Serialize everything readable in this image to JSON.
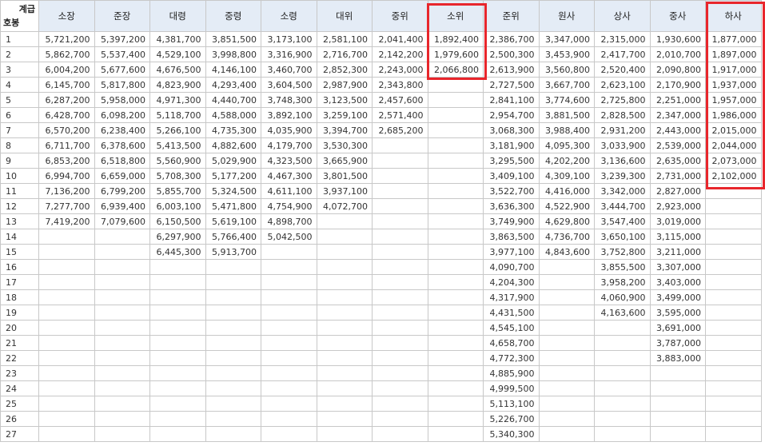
{
  "corner": {
    "grade_label": "계급",
    "step_label": "호봉"
  },
  "columns": [
    "소장",
    "준장",
    "대령",
    "중령",
    "소령",
    "대위",
    "중위",
    "소위",
    "준위",
    "원사",
    "상사",
    "중사",
    "하사"
  ],
  "rows": [
    {
      "n": "1",
      "v": [
        "5,721,200",
        "5,397,200",
        "4,381,700",
        "3,851,500",
        "3,173,100",
        "2,581,100",
        "2,041,400",
        "1,892,400",
        "2,386,700",
        "3,347,000",
        "2,315,000",
        "1,930,600",
        "1,877,000"
      ]
    },
    {
      "n": "2",
      "v": [
        "5,862,700",
        "5,537,400",
        "4,529,100",
        "3,998,800",
        "3,316,900",
        "2,716,700",
        "2,142,200",
        "1,979,600",
        "2,500,300",
        "3,453,900",
        "2,417,700",
        "2,010,700",
        "1,897,000"
      ]
    },
    {
      "n": "3",
      "v": [
        "6,004,200",
        "5,677,600",
        "4,676,500",
        "4,146,100",
        "3,460,700",
        "2,852,300",
        "2,243,000",
        "2,066,800",
        "2,613,900",
        "3,560,800",
        "2,520,400",
        "2,090,800",
        "1,917,000"
      ]
    },
    {
      "n": "4",
      "v": [
        "6,145,700",
        "5,817,800",
        "4,823,900",
        "4,293,400",
        "3,604,500",
        "2,987,900",
        "2,343,800",
        "",
        "2,727,500",
        "3,667,700",
        "2,623,100",
        "2,170,900",
        "1,937,000"
      ]
    },
    {
      "n": "5",
      "v": [
        "6,287,200",
        "5,958,000",
        "4,971,300",
        "4,440,700",
        "3,748,300",
        "3,123,500",
        "2,457,600",
        "",
        "2,841,100",
        "3,774,600",
        "2,725,800",
        "2,251,000",
        "1,957,000"
      ]
    },
    {
      "n": "6",
      "v": [
        "6,428,700",
        "6,098,200",
        "5,118,700",
        "4,588,000",
        "3,892,100",
        "3,259,100",
        "2,571,400",
        "",
        "2,954,700",
        "3,881,500",
        "2,828,500",
        "2,347,000",
        "1,986,000"
      ]
    },
    {
      "n": "7",
      "v": [
        "6,570,200",
        "6,238,400",
        "5,266,100",
        "4,735,300",
        "4,035,900",
        "3,394,700",
        "2,685,200",
        "",
        "3,068,300",
        "3,988,400",
        "2,931,200",
        "2,443,000",
        "2,015,000"
      ]
    },
    {
      "n": "8",
      "v": [
        "6,711,700",
        "6,378,600",
        "5,413,500",
        "4,882,600",
        "4,179,700",
        "3,530,300",
        "",
        "",
        "3,181,900",
        "4,095,300",
        "3,033,900",
        "2,539,000",
        "2,044,000"
      ]
    },
    {
      "n": "9",
      "v": [
        "6,853,200",
        "6,518,800",
        "5,560,900",
        "5,029,900",
        "4,323,500",
        "3,665,900",
        "",
        "",
        "3,295,500",
        "4,202,200",
        "3,136,600",
        "2,635,000",
        "2,073,000"
      ]
    },
    {
      "n": "10",
      "v": [
        "6,994,700",
        "6,659,000",
        "5,708,300",
        "5,177,200",
        "4,467,300",
        "3,801,500",
        "",
        "",
        "3,409,100",
        "4,309,100",
        "3,239,300",
        "2,731,000",
        "2,102,000"
      ]
    },
    {
      "n": "11",
      "v": [
        "7,136,200",
        "6,799,200",
        "5,855,700",
        "5,324,500",
        "4,611,100",
        "3,937,100",
        "",
        "",
        "3,522,700",
        "4,416,000",
        "3,342,000",
        "2,827,000",
        ""
      ]
    },
    {
      "n": "12",
      "v": [
        "7,277,700",
        "6,939,400",
        "6,003,100",
        "5,471,800",
        "4,754,900",
        "4,072,700",
        "",
        "",
        "3,636,300",
        "4,522,900",
        "3,444,700",
        "2,923,000",
        ""
      ]
    },
    {
      "n": "13",
      "v": [
        "7,419,200",
        "7,079,600",
        "6,150,500",
        "5,619,100",
        "4,898,700",
        "",
        "",
        "",
        "3,749,900",
        "4,629,800",
        "3,547,400",
        "3,019,000",
        ""
      ]
    },
    {
      "n": "14",
      "v": [
        "",
        "",
        "6,297,900",
        "5,766,400",
        "5,042,500",
        "",
        "",
        "",
        "3,863,500",
        "4,736,700",
        "3,650,100",
        "3,115,000",
        ""
      ]
    },
    {
      "n": "15",
      "v": [
        "",
        "",
        "6,445,300",
        "5,913,700",
        "",
        "",
        "",
        "",
        "3,977,100",
        "4,843,600",
        "3,752,800",
        "3,211,000",
        ""
      ]
    },
    {
      "n": "16",
      "v": [
        "",
        "",
        "",
        "",
        "",
        "",
        "",
        "",
        "4,090,700",
        "",
        "3,855,500",
        "3,307,000",
        ""
      ]
    },
    {
      "n": "17",
      "v": [
        "",
        "",
        "",
        "",
        "",
        "",
        "",
        "",
        "4,204,300",
        "",
        "3,958,200",
        "3,403,000",
        ""
      ]
    },
    {
      "n": "18",
      "v": [
        "",
        "",
        "",
        "",
        "",
        "",
        "",
        "",
        "4,317,900",
        "",
        "4,060,900",
        "3,499,000",
        ""
      ]
    },
    {
      "n": "19",
      "v": [
        "",
        "",
        "",
        "",
        "",
        "",
        "",
        "",
        "4,431,500",
        "",
        "4,163,600",
        "3,595,000",
        ""
      ]
    },
    {
      "n": "20",
      "v": [
        "",
        "",
        "",
        "",
        "",
        "",
        "",
        "",
        "4,545,100",
        "",
        "",
        "3,691,000",
        ""
      ]
    },
    {
      "n": "21",
      "v": [
        "",
        "",
        "",
        "",
        "",
        "",
        "",
        "",
        "4,658,700",
        "",
        "",
        "3,787,000",
        ""
      ]
    },
    {
      "n": "22",
      "v": [
        "",
        "",
        "",
        "",
        "",
        "",
        "",
        "",
        "4,772,300",
        "",
        "",
        "3,883,000",
        ""
      ]
    },
    {
      "n": "23",
      "v": [
        "",
        "",
        "",
        "",
        "",
        "",
        "",
        "",
        "4,885,900",
        "",
        "",
        "",
        ""
      ]
    },
    {
      "n": "24",
      "v": [
        "",
        "",
        "",
        "",
        "",
        "",
        "",
        "",
        "4,999,500",
        "",
        "",
        "",
        ""
      ]
    },
    {
      "n": "25",
      "v": [
        "",
        "",
        "",
        "",
        "",
        "",
        "",
        "",
        "5,113,100",
        "",
        "",
        "",
        ""
      ]
    },
    {
      "n": "26",
      "v": [
        "",
        "",
        "",
        "",
        "",
        "",
        "",
        "",
        "5,226,700",
        "",
        "",
        "",
        ""
      ]
    },
    {
      "n": "27",
      "v": [
        "",
        "",
        "",
        "",
        "",
        "",
        "",
        "",
        "5,340,300",
        "",
        "",
        "",
        ""
      ]
    }
  ],
  "highlight_color": "#e8262c"
}
